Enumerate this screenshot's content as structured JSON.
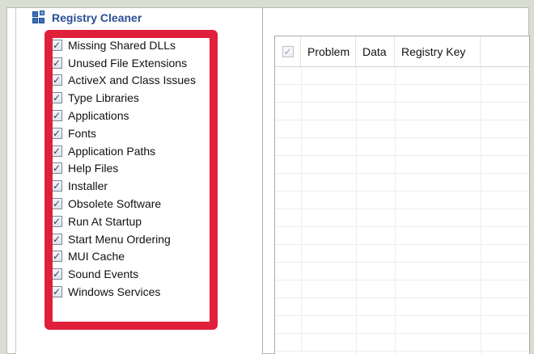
{
  "title": "Registry Cleaner",
  "check_glyph": "✓",
  "items": [
    {
      "label": "Missing Shared DLLs",
      "checked": true
    },
    {
      "label": "Unused File Extensions",
      "checked": true
    },
    {
      "label": "ActiveX and Class Issues",
      "checked": true
    },
    {
      "label": "Type Libraries",
      "checked": true
    },
    {
      "label": "Applications",
      "checked": true
    },
    {
      "label": "Fonts",
      "checked": true
    },
    {
      "label": "Application Paths",
      "checked": true
    },
    {
      "label": "Help Files",
      "checked": true
    },
    {
      "label": "Installer",
      "checked": true
    },
    {
      "label": "Obsolete Software",
      "checked": true
    },
    {
      "label": "Run At Startup",
      "checked": true
    },
    {
      "label": "Start Menu Ordering",
      "checked": true
    },
    {
      "label": "MUI Cache",
      "checked": true
    },
    {
      "label": "Sound Events",
      "checked": true
    },
    {
      "label": "Windows Services",
      "checked": true
    }
  ],
  "grid": {
    "columns": [
      "Problem",
      "Data",
      "Registry Key"
    ],
    "rows": []
  },
  "colors": {
    "highlight": "#e0203b",
    "title": "#2a4f96"
  }
}
